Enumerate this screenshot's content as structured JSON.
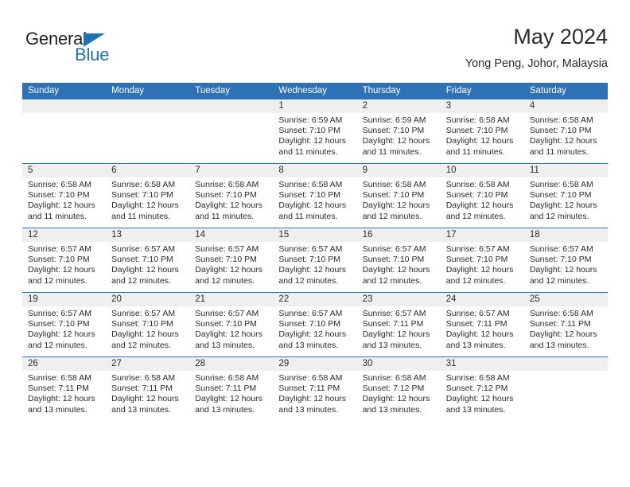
{
  "logo": {
    "word_one": "General",
    "word_two": "Blue",
    "triangle_color": "#1d72b8",
    "text_color": "#231f20"
  },
  "header": {
    "title": "May 2024",
    "subtitle": "Yong Peng, Johor, Malaysia"
  },
  "theme": {
    "header_blue": "#2e71b5",
    "daynum_band": "#efefef",
    "text": "#2b2b2b",
    "cell_background": "#ffffff"
  },
  "calendar": {
    "weekday_headers": [
      "Sunday",
      "Monday",
      "Tuesday",
      "Wednesday",
      "Thursday",
      "Friday",
      "Saturday"
    ],
    "weeks": [
      [
        {
          "day": "",
          "empty": true
        },
        {
          "day": "",
          "empty": true
        },
        {
          "day": "",
          "empty": true
        },
        {
          "day": "1",
          "sunrise": "Sunrise: 6:59 AM",
          "sunset": "Sunset: 7:10 PM",
          "daylight": "Daylight: 12 hours and 11 minutes."
        },
        {
          "day": "2",
          "sunrise": "Sunrise: 6:59 AM",
          "sunset": "Sunset: 7:10 PM",
          "daylight": "Daylight: 12 hours and 11 minutes."
        },
        {
          "day": "3",
          "sunrise": "Sunrise: 6:58 AM",
          "sunset": "Sunset: 7:10 PM",
          "daylight": "Daylight: 12 hours and 11 minutes."
        },
        {
          "day": "4",
          "sunrise": "Sunrise: 6:58 AM",
          "sunset": "Sunset: 7:10 PM",
          "daylight": "Daylight: 12 hours and 11 minutes."
        }
      ],
      [
        {
          "day": "5",
          "sunrise": "Sunrise: 6:58 AM",
          "sunset": "Sunset: 7:10 PM",
          "daylight": "Daylight: 12 hours and 11 minutes."
        },
        {
          "day": "6",
          "sunrise": "Sunrise: 6:58 AM",
          "sunset": "Sunset: 7:10 PM",
          "daylight": "Daylight: 12 hours and 11 minutes."
        },
        {
          "day": "7",
          "sunrise": "Sunrise: 6:58 AM",
          "sunset": "Sunset: 7:10 PM",
          "daylight": "Daylight: 12 hours and 11 minutes."
        },
        {
          "day": "8",
          "sunrise": "Sunrise: 6:58 AM",
          "sunset": "Sunset: 7:10 PM",
          "daylight": "Daylight: 12 hours and 11 minutes."
        },
        {
          "day": "9",
          "sunrise": "Sunrise: 6:58 AM",
          "sunset": "Sunset: 7:10 PM",
          "daylight": "Daylight: 12 hours and 12 minutes."
        },
        {
          "day": "10",
          "sunrise": "Sunrise: 6:58 AM",
          "sunset": "Sunset: 7:10 PM",
          "daylight": "Daylight: 12 hours and 12 minutes."
        },
        {
          "day": "11",
          "sunrise": "Sunrise: 6:58 AM",
          "sunset": "Sunset: 7:10 PM",
          "daylight": "Daylight: 12 hours and 12 minutes."
        }
      ],
      [
        {
          "day": "12",
          "sunrise": "Sunrise: 6:57 AM",
          "sunset": "Sunset: 7:10 PM",
          "daylight": "Daylight: 12 hours and 12 minutes."
        },
        {
          "day": "13",
          "sunrise": "Sunrise: 6:57 AM",
          "sunset": "Sunset: 7:10 PM",
          "daylight": "Daylight: 12 hours and 12 minutes."
        },
        {
          "day": "14",
          "sunrise": "Sunrise: 6:57 AM",
          "sunset": "Sunset: 7:10 PM",
          "daylight": "Daylight: 12 hours and 12 minutes."
        },
        {
          "day": "15",
          "sunrise": "Sunrise: 6:57 AM",
          "sunset": "Sunset: 7:10 PM",
          "daylight": "Daylight: 12 hours and 12 minutes."
        },
        {
          "day": "16",
          "sunrise": "Sunrise: 6:57 AM",
          "sunset": "Sunset: 7:10 PM",
          "daylight": "Daylight: 12 hours and 12 minutes."
        },
        {
          "day": "17",
          "sunrise": "Sunrise: 6:57 AM",
          "sunset": "Sunset: 7:10 PM",
          "daylight": "Daylight: 12 hours and 12 minutes."
        },
        {
          "day": "18",
          "sunrise": "Sunrise: 6:57 AM",
          "sunset": "Sunset: 7:10 PM",
          "daylight": "Daylight: 12 hours and 12 minutes."
        }
      ],
      [
        {
          "day": "19",
          "sunrise": "Sunrise: 6:57 AM",
          "sunset": "Sunset: 7:10 PM",
          "daylight": "Daylight: 12 hours and 12 minutes."
        },
        {
          "day": "20",
          "sunrise": "Sunrise: 6:57 AM",
          "sunset": "Sunset: 7:10 PM",
          "daylight": "Daylight: 12 hours and 12 minutes."
        },
        {
          "day": "21",
          "sunrise": "Sunrise: 6:57 AM",
          "sunset": "Sunset: 7:10 PM",
          "daylight": "Daylight: 12 hours and 13 minutes."
        },
        {
          "day": "22",
          "sunrise": "Sunrise: 6:57 AM",
          "sunset": "Sunset: 7:10 PM",
          "daylight": "Daylight: 12 hours and 13 minutes."
        },
        {
          "day": "23",
          "sunrise": "Sunrise: 6:57 AM",
          "sunset": "Sunset: 7:11 PM",
          "daylight": "Daylight: 12 hours and 13 minutes."
        },
        {
          "day": "24",
          "sunrise": "Sunrise: 6:57 AM",
          "sunset": "Sunset: 7:11 PM",
          "daylight": "Daylight: 12 hours and 13 minutes."
        },
        {
          "day": "25",
          "sunrise": "Sunrise: 6:58 AM",
          "sunset": "Sunset: 7:11 PM",
          "daylight": "Daylight: 12 hours and 13 minutes."
        }
      ],
      [
        {
          "day": "26",
          "sunrise": "Sunrise: 6:58 AM",
          "sunset": "Sunset: 7:11 PM",
          "daylight": "Daylight: 12 hours and 13 minutes."
        },
        {
          "day": "27",
          "sunrise": "Sunrise: 6:58 AM",
          "sunset": "Sunset: 7:11 PM",
          "daylight": "Daylight: 12 hours and 13 minutes."
        },
        {
          "day": "28",
          "sunrise": "Sunrise: 6:58 AM",
          "sunset": "Sunset: 7:11 PM",
          "daylight": "Daylight: 12 hours and 13 minutes."
        },
        {
          "day": "29",
          "sunrise": "Sunrise: 6:58 AM",
          "sunset": "Sunset: 7:11 PM",
          "daylight": "Daylight: 12 hours and 13 minutes."
        },
        {
          "day": "30",
          "sunrise": "Sunrise: 6:58 AM",
          "sunset": "Sunset: 7:12 PM",
          "daylight": "Daylight: 12 hours and 13 minutes."
        },
        {
          "day": "31",
          "sunrise": "Sunrise: 6:58 AM",
          "sunset": "Sunset: 7:12 PM",
          "daylight": "Daylight: 12 hours and 13 minutes."
        },
        {
          "day": "",
          "empty": true
        }
      ]
    ]
  }
}
